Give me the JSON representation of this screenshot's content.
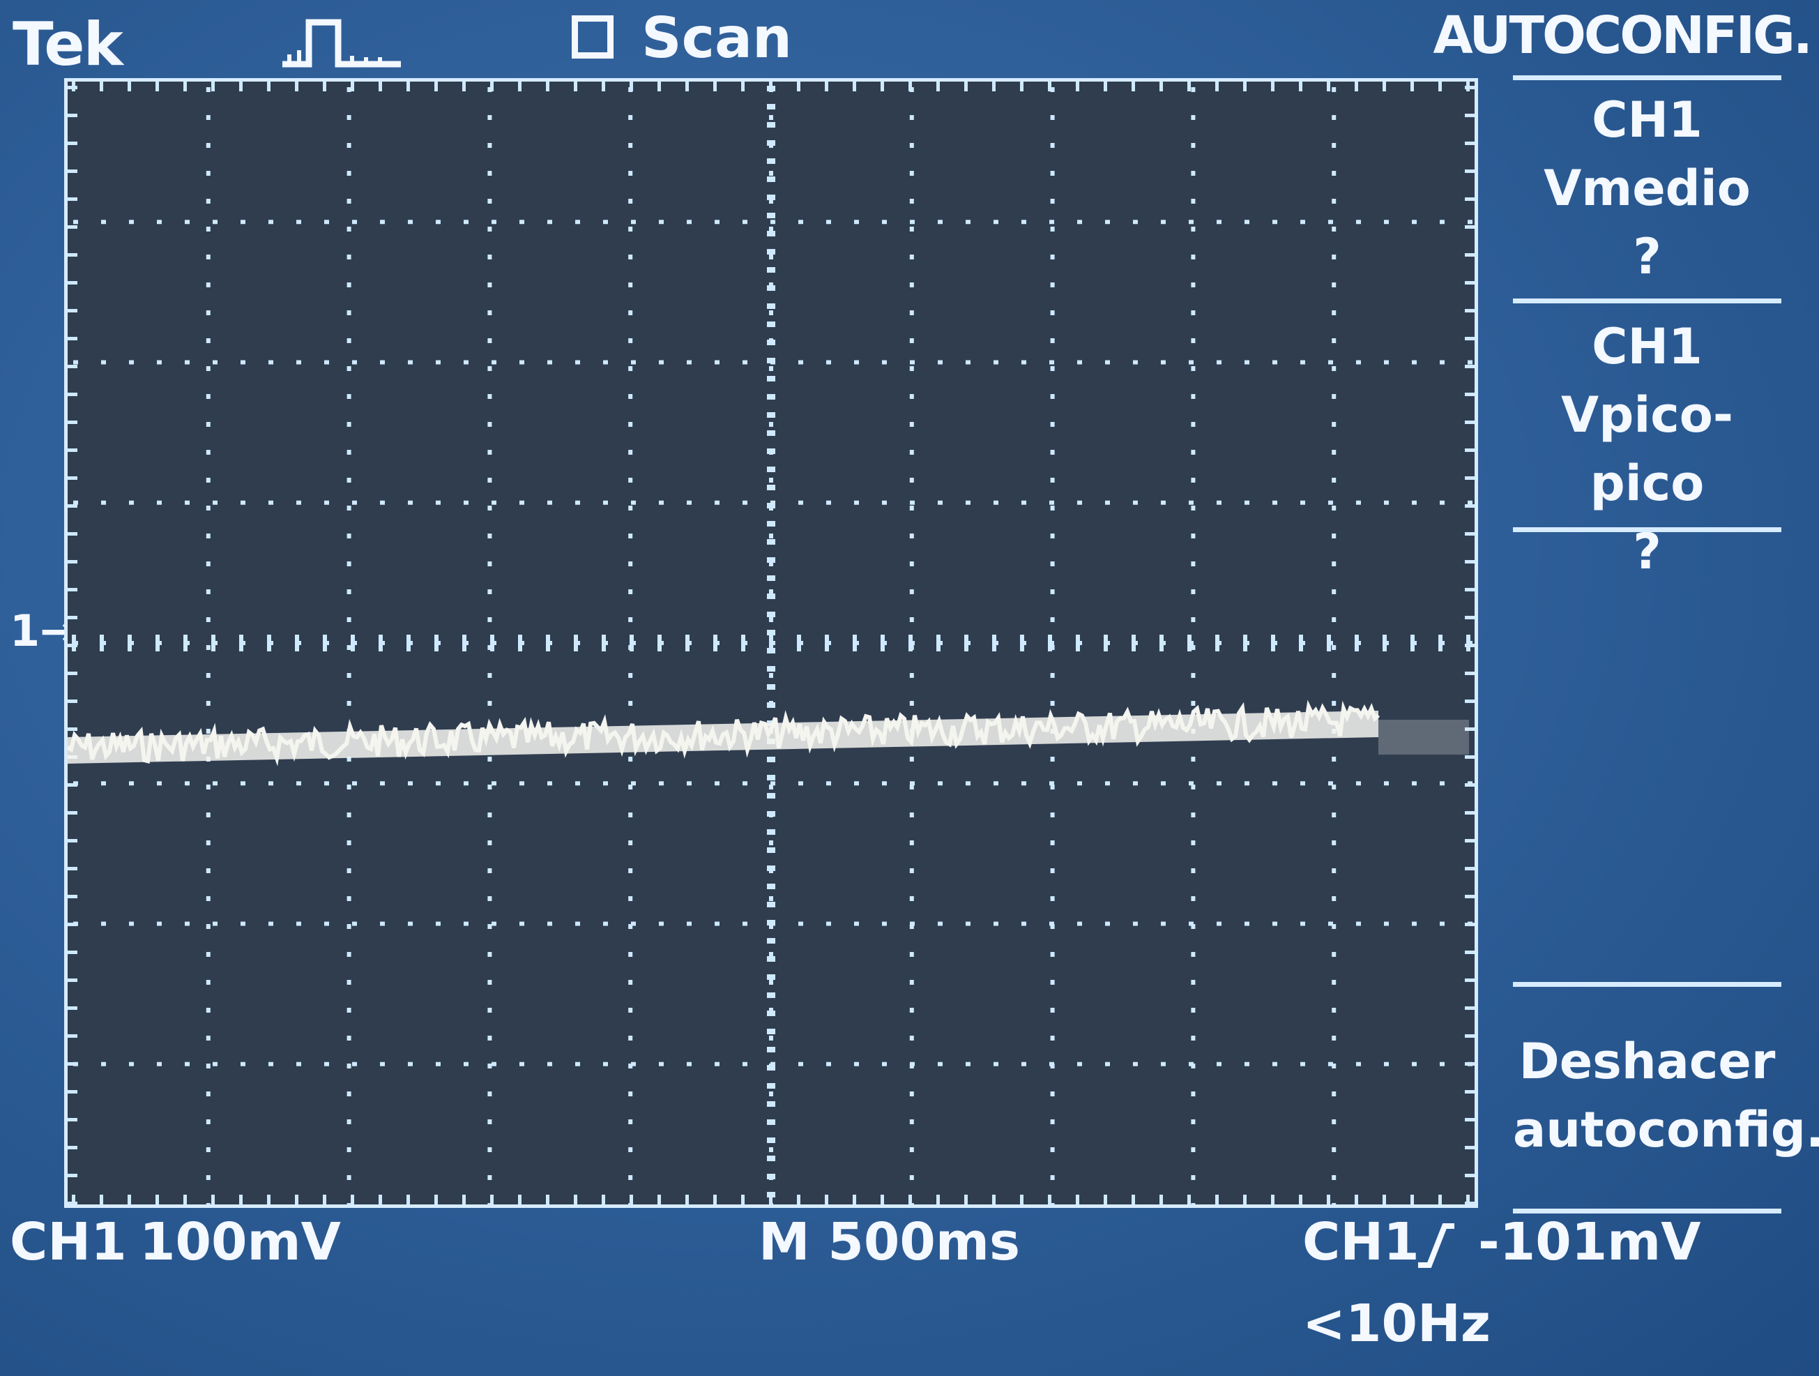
{
  "topbar": {
    "brand": "Tek",
    "scan_label": "Scan",
    "acquisition_state_icon": "run-pulse-icon",
    "menu_title": "AUTOCONFIG."
  },
  "display": {
    "channel_marker": "1",
    "trace_color": "#f4f4f0",
    "grid_color": "#cfe9ff",
    "screen_background": "#2f3d4f",
    "frame_color": "#2a5a8f"
  },
  "side_menu": [
    {
      "line1": "CH1",
      "line2": "Vmedio",
      "line3": "?"
    },
    {
      "line1": "CH1",
      "line2": "Vpico-pico",
      "line3": "?"
    },
    {
      "line1": "Deshacer",
      "line2": "autoconfig.",
      "line3": ""
    }
  ],
  "status_bar": {
    "ch1_label": "CH1",
    "ch1_scale": "100mV",
    "timebase": "M 500ms",
    "trigger_source": "CH1",
    "trigger_slope_icon": "rising-edge-icon",
    "trigger_level": "-101mV",
    "trigger_frequency": "<10Hz"
  }
}
